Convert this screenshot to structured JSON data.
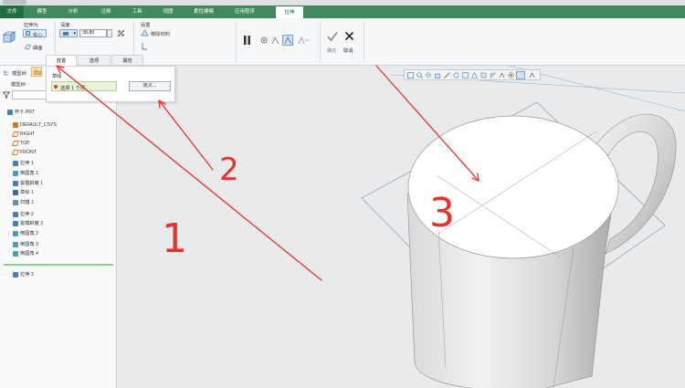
{
  "ribbon": {
    "tabs": [
      {
        "label": "文件",
        "active": false,
        "file": true
      },
      {
        "label": "模型",
        "active": false
      },
      {
        "label": "分析",
        "active": false
      },
      {
        "label": "注释",
        "active": false
      },
      {
        "label": "工具",
        "active": false
      },
      {
        "label": "视图",
        "active": false
      },
      {
        "label": "柔性建模",
        "active": false
      },
      {
        "label": "应用程序",
        "active": false
      },
      {
        "label": "拉伸",
        "active": true
      }
    ],
    "type_group": {
      "label": "拉伸为",
      "solid_label": "实心",
      "surface_label": "曲面"
    },
    "depth_group": {
      "label": "深度",
      "value": "38.80"
    },
    "settings_group": {
      "label": "设置",
      "remove_material_label": "移除材料"
    },
    "ok_label": "确定",
    "cancel_label": "取消"
  },
  "dashboard": {
    "tabs": [
      "放置",
      "选项",
      "属性"
    ],
    "placement": {
      "section_label": "草绘",
      "selection": "选择 1 个项",
      "define_button": "定义..."
    }
  },
  "model_panel": {
    "tabs": [
      "模型树"
    ],
    "title_label": "模型树",
    "filter_placeholder": "",
    "tree": [
      {
        "label": "杯子.PRT",
        "icon": "part-icon"
      },
      {
        "label": "DEFAULT_CSYS",
        "icon": "csys-icon"
      },
      {
        "label": "RIGHT",
        "icon": "datum-plane-icon"
      },
      {
        "label": "TOP",
        "icon": "datum-plane-icon"
      },
      {
        "label": "FRONT",
        "icon": "datum-plane-icon"
      },
      {
        "label": "拉伸 1",
        "icon": "extrude-icon"
      },
      {
        "label": "倒圆角 1",
        "icon": "round-icon"
      },
      {
        "label": "拔模斜度 1",
        "icon": "draft-icon"
      },
      {
        "label": "草绘 1",
        "icon": "sketch-icon"
      },
      {
        "label": "扫描 1",
        "icon": "sweep-icon"
      },
      {
        "label": "拉伸 2",
        "icon": "extrude-icon"
      },
      {
        "label": "拔模斜度 2",
        "icon": "draft-icon"
      },
      {
        "label": "倒圆角 2",
        "icon": "round-icon"
      },
      {
        "label": "倒圆角 3",
        "icon": "round-icon"
      },
      {
        "label": "倒圆角 4",
        "icon": "round-icon"
      },
      {
        "label": "拉伸 3",
        "icon": "extrude-icon"
      }
    ]
  },
  "annotations": {
    "n1": "1",
    "n2": "2",
    "n3": "3"
  },
  "colors": {
    "ribbon_green": "#3f8a5c",
    "annotation_red": "#e8322a",
    "insert_marker": "#8ed18a"
  }
}
